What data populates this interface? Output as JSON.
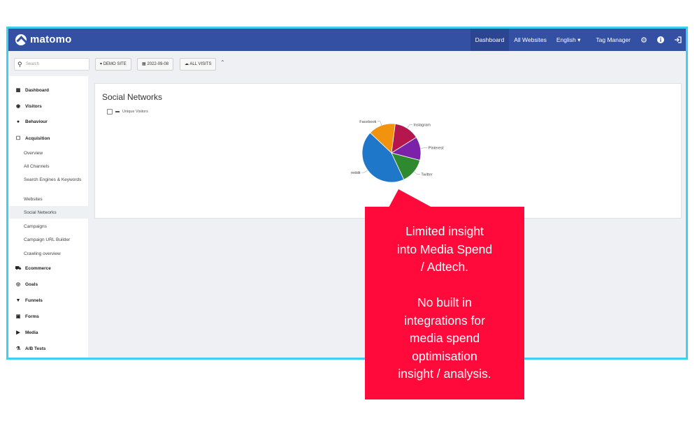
{
  "app": {
    "logo_text": "matomo"
  },
  "nav": {
    "items": [
      "Dashboard",
      "All Websites",
      "English ▾",
      "Tag Manager"
    ],
    "icons": [
      "gear-icon",
      "info-icon",
      "logout-icon"
    ]
  },
  "toolbar": {
    "search_placeholder": "Search",
    "site_label": "DEMO SITE",
    "date_label": "2022-09-08",
    "segment_label": "ALL VISITS"
  },
  "sidebar": {
    "top": [
      "Dashboard",
      "Visitors",
      "Behaviour",
      "Acquisition"
    ],
    "acquisition_sub": [
      "Overview",
      "All Channels",
      "Search Engines & Keywords",
      "Websites",
      "Social Networks",
      "Campaigns",
      "Campaign URL Builder",
      "Crawling overview"
    ],
    "bottom": [
      "Ecommerce",
      "Goals",
      "Funnels",
      "Forms",
      "Media",
      "A/B Tests"
    ]
  },
  "report": {
    "title": "Social Networks",
    "legend_label": "Unique Visitors"
  },
  "chart_data": {
    "type": "pie",
    "categories": [
      "reddit",
      "Facebook",
      "Instagram",
      "Pinterest",
      "Twitter"
    ],
    "values": [
      44,
      15,
      14,
      13,
      14
    ],
    "colors": [
      "#1f77c9",
      "#f2930d",
      "#b5174d",
      "#7b22a8",
      "#2f8a2f"
    ]
  },
  "callout": {
    "line1": "Limited insight",
    "line2": "into Media Spend",
    "line3": "/ Adtech.",
    "line4": "No built in",
    "line5": "integrations for",
    "line6": "media spend",
    "line7": "optimisation",
    "line8": "insight / analysis."
  }
}
